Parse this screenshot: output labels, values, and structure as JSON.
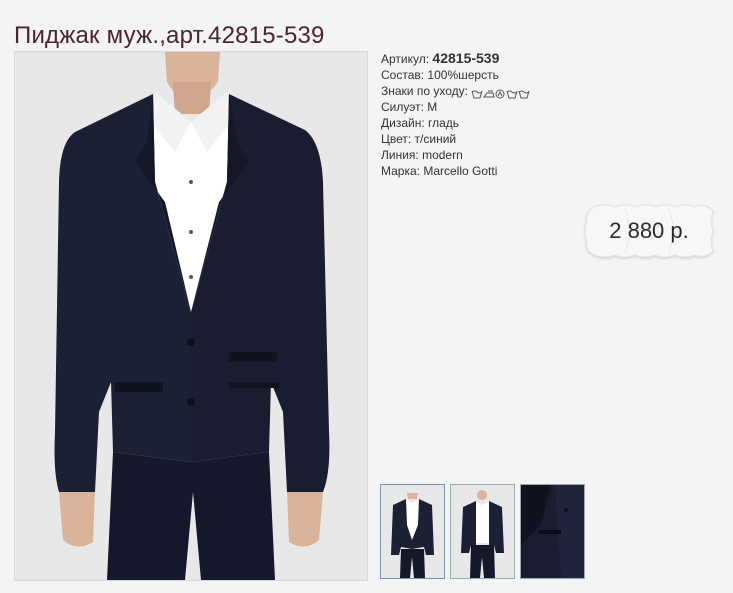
{
  "page": {
    "title": "Пиджак муж.,арт.42815-539"
  },
  "details": {
    "sku_label": "Артикул:",
    "sku_value": "42815-539",
    "composition": "Состав: 100%шерсть",
    "care_label": "Знаки по уходу:",
    "care_icons": [
      "wash-icon",
      "iron-icon",
      "dry-clean-icon",
      "wash-icon",
      "wash-icon"
    ],
    "silhouette": "Силуэт: М",
    "design": "Дизайн: гладь",
    "color": "Цвет: т/синий",
    "line": "Линия: modern",
    "brand": "Марка: Marcello Gotti"
  },
  "price": {
    "value": "2 880 р."
  },
  "colors": {
    "title": "#4a2430",
    "jacket": "#1c2035",
    "shirt": "#ffffff",
    "background": "#f4f4f4"
  },
  "thumbnails": [
    {
      "name": "front-view"
    },
    {
      "name": "front-open-view"
    },
    {
      "name": "pocket-detail-view"
    }
  ]
}
